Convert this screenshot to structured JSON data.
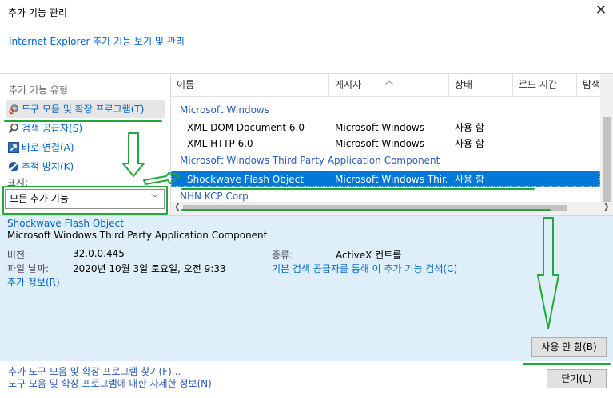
{
  "window": {
    "title": "추가 기능 관리",
    "close_glyph": "✕",
    "subtitle": "Internet Explorer 추가 기능 보기 및 관리"
  },
  "sidebar": {
    "heading": "추가 기능 유형",
    "items": [
      {
        "label": "도구 모음 및 확장 프로그램(T)",
        "icon": "gear-icon",
        "selected": true
      },
      {
        "label": "검색 공급자(S)",
        "icon": "search-icon",
        "selected": false
      },
      {
        "label": "바로 연결(A)",
        "icon": "accelerator-icon",
        "selected": false
      },
      {
        "label": "추적 방지(K)",
        "icon": "block-icon",
        "selected": false
      }
    ],
    "show_label": "표시:",
    "show_value": "모든 추가 기능"
  },
  "list": {
    "columns": [
      "이름",
      "게시자",
      "상태",
      "로드 시간",
      "탐색"
    ],
    "groups": [
      {
        "name": "Microsoft Windows",
        "rows": [
          {
            "name": "XML DOM Document 6.0",
            "publisher": "Microsoft Windows",
            "status": "사용 함"
          },
          {
            "name": "XML HTTP 6.0",
            "publisher": "Microsoft Windows",
            "status": "사용 함"
          }
        ]
      },
      {
        "name": "Microsoft Windows Third Party Application Component",
        "rows": [
          {
            "name": "Shockwave Flash Object",
            "publisher": "Microsoft Windows Thir...",
            "status": "사용 함",
            "selected": true
          }
        ]
      },
      {
        "name": "NHN KCP Corp",
        "rows": []
      }
    ]
  },
  "details": {
    "name": "Shockwave Flash Object",
    "publisher": "Microsoft Windows Third Party Application Component",
    "version_label": "버전:",
    "version_value": "32.0.0.445",
    "date_label": "파일 날짜:",
    "date_value": "2020년 10월 3일 토요일, 오전 9:33",
    "more_info": "추가 정보(R)",
    "type_label": "종류:",
    "type_value": "ActiveX 컨트롤",
    "search_link": "기본 검색 공급자를 통해 이 추가 기능 검색(C)",
    "disable_button": "사용 안 함(B)"
  },
  "footer": {
    "link1": "추가 도구 모음 및 확장 프로그램 찾기(F)...",
    "link2": "도구 모음 및 확장 프로그램에 대한 자세한 정보(N)",
    "close_button": "닫기(L)"
  },
  "colors": {
    "annotation": "#22a83a",
    "selection": "#0078d7",
    "link": "#0066cc",
    "detail_background": "#dfeff9"
  }
}
